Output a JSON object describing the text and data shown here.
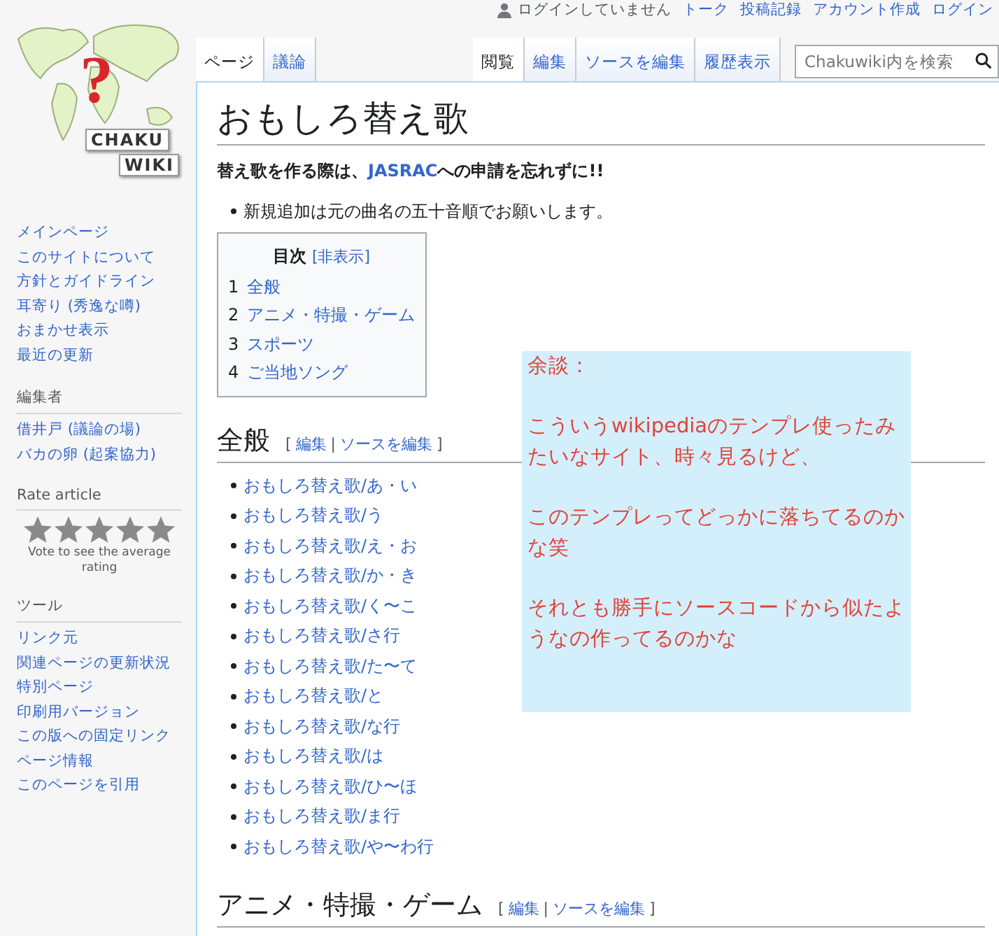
{
  "logo": {
    "mark": "?",
    "line1": "CHAKU",
    "line2": "WIKI"
  },
  "personal": {
    "status": "ログインしていません",
    "links": [
      "トーク",
      "投稿記録",
      "アカウント作成",
      "ログイン"
    ]
  },
  "left_tabs": [
    {
      "label": "ページ",
      "selected": true
    },
    {
      "label": "議論",
      "selected": false
    }
  ],
  "right_tabs": [
    {
      "label": "閲覧",
      "selected": true
    },
    {
      "label": "編集",
      "selected": false
    },
    {
      "label": "ソースを編集",
      "selected": false
    },
    {
      "label": "履歴表示",
      "selected": false
    }
  ],
  "search": {
    "placeholder": "Chakuwiki内を検索"
  },
  "sidebar": {
    "nav": [
      "メインページ",
      "このサイトについて",
      "方針とガイドライン",
      "耳寄り (秀逸な噂)",
      "おまかせ表示",
      "最近の更新"
    ],
    "sections": [
      {
        "heading": "編集者",
        "items": [
          "借井戸 (議論の場)",
          "バカの卵 (起案協力)"
        ]
      }
    ],
    "rating": {
      "heading": "Rate article",
      "caption": "Vote to see the average rating"
    },
    "tools": {
      "heading": "ツール",
      "items": [
        "リンク元",
        "関連ページの更新状況",
        "特別ページ",
        "印刷用バージョン",
        "この版への固定リンク",
        "ページ情報",
        "このページを引用"
      ]
    }
  },
  "title": "おもしろ替え歌",
  "notice": {
    "before": "替え歌を作る際は、",
    "link": "JASRAC",
    "after": "への申請を忘れずに!!"
  },
  "bullet": "新規追加は元の曲名の五十音順でお願いします。",
  "toc": {
    "title": "目次",
    "toggle": "[非表示]",
    "items": [
      {
        "number": "1",
        "label": "全般"
      },
      {
        "number": "2",
        "label": "アニメ・特撮・ゲーム"
      },
      {
        "number": "3",
        "label": "スポーツ"
      },
      {
        "number": "4",
        "label": "ご当地ソング"
      }
    ]
  },
  "sections": [
    {
      "heading": "全般",
      "open": "[",
      "edit": "編集",
      "separator": "|",
      "edit_source": "ソースを編集",
      "close": "]",
      "items": [
        "おもしろ替え歌/あ・い",
        "おもしろ替え歌/う",
        "おもしろ替え歌/え・お",
        "おもしろ替え歌/か・き",
        "おもしろ替え歌/く〜こ",
        "おもしろ替え歌/さ行",
        "おもしろ替え歌/た〜て",
        "おもしろ替え歌/と",
        "おもしろ替え歌/な行",
        "おもしろ替え歌/は",
        "おもしろ替え歌/ひ〜ほ",
        "おもしろ替え歌/ま行",
        "おもしろ替え歌/や〜わ行"
      ]
    },
    {
      "heading": "アニメ・特撮・ゲーム",
      "open": "[",
      "edit": "編集",
      "separator": "|",
      "edit_source": "ソースを編集",
      "close": "]"
    }
  ],
  "note": {
    "paragraphs": [
      "余談：",
      "こういうwikipediaのテンプレ使ったみたいなサイト、時々見るけど、",
      "このテンプレってどっかに落ちてるのかな笑",
      "それとも勝手にソースコードから似たようなの作ってるのかな"
    ]
  }
}
